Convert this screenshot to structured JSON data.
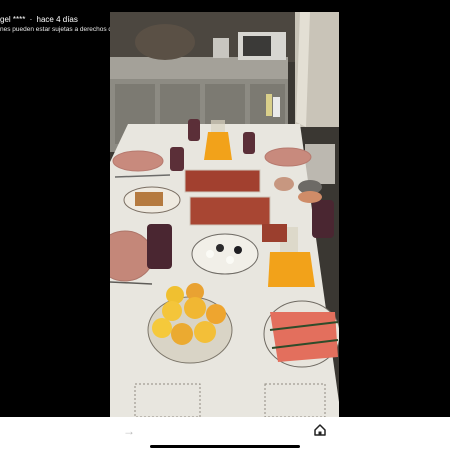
{
  "status": {
    "username": "gel ****",
    "separator": "·",
    "time_ago": "hace 4 días",
    "copyright": "nes pueden estar sujetas a derechos de autor"
  },
  "photo": {
    "subject": "breakfast-table"
  },
  "nav": {
    "forward_icon": "arrow-right-icon",
    "home_icon": "home-icon"
  },
  "colors": {
    "background": "#000000",
    "nav_bar": "#ffffff",
    "tablecloth": "#e8e6df",
    "orange_juice": "#f2a21a"
  }
}
